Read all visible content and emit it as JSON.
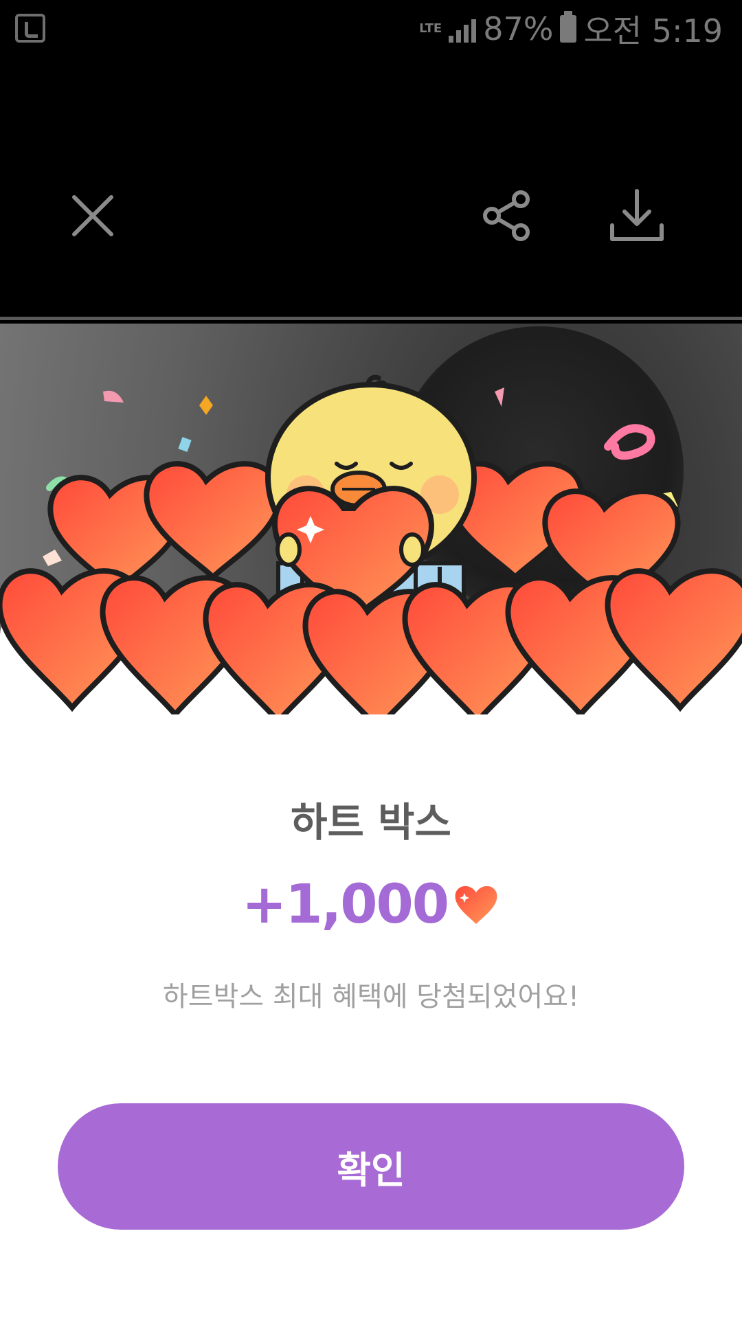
{
  "status_bar": {
    "network": "LTE",
    "battery_percent": "87%",
    "time": "오전 5:19"
  },
  "toolbar": {
    "icons": [
      "close-icon",
      "share-icon",
      "download-icon"
    ]
  },
  "reward": {
    "title": "하트 박스",
    "amount": "+1,000",
    "message": "하트박스 최대 혜택에 당첨되었어요!",
    "confirm_label": "확인"
  },
  "colors": {
    "accent_purple": "#a86ad4",
    "amount_purple": "#a46bd6",
    "heart_red": "#ff5a4a"
  }
}
